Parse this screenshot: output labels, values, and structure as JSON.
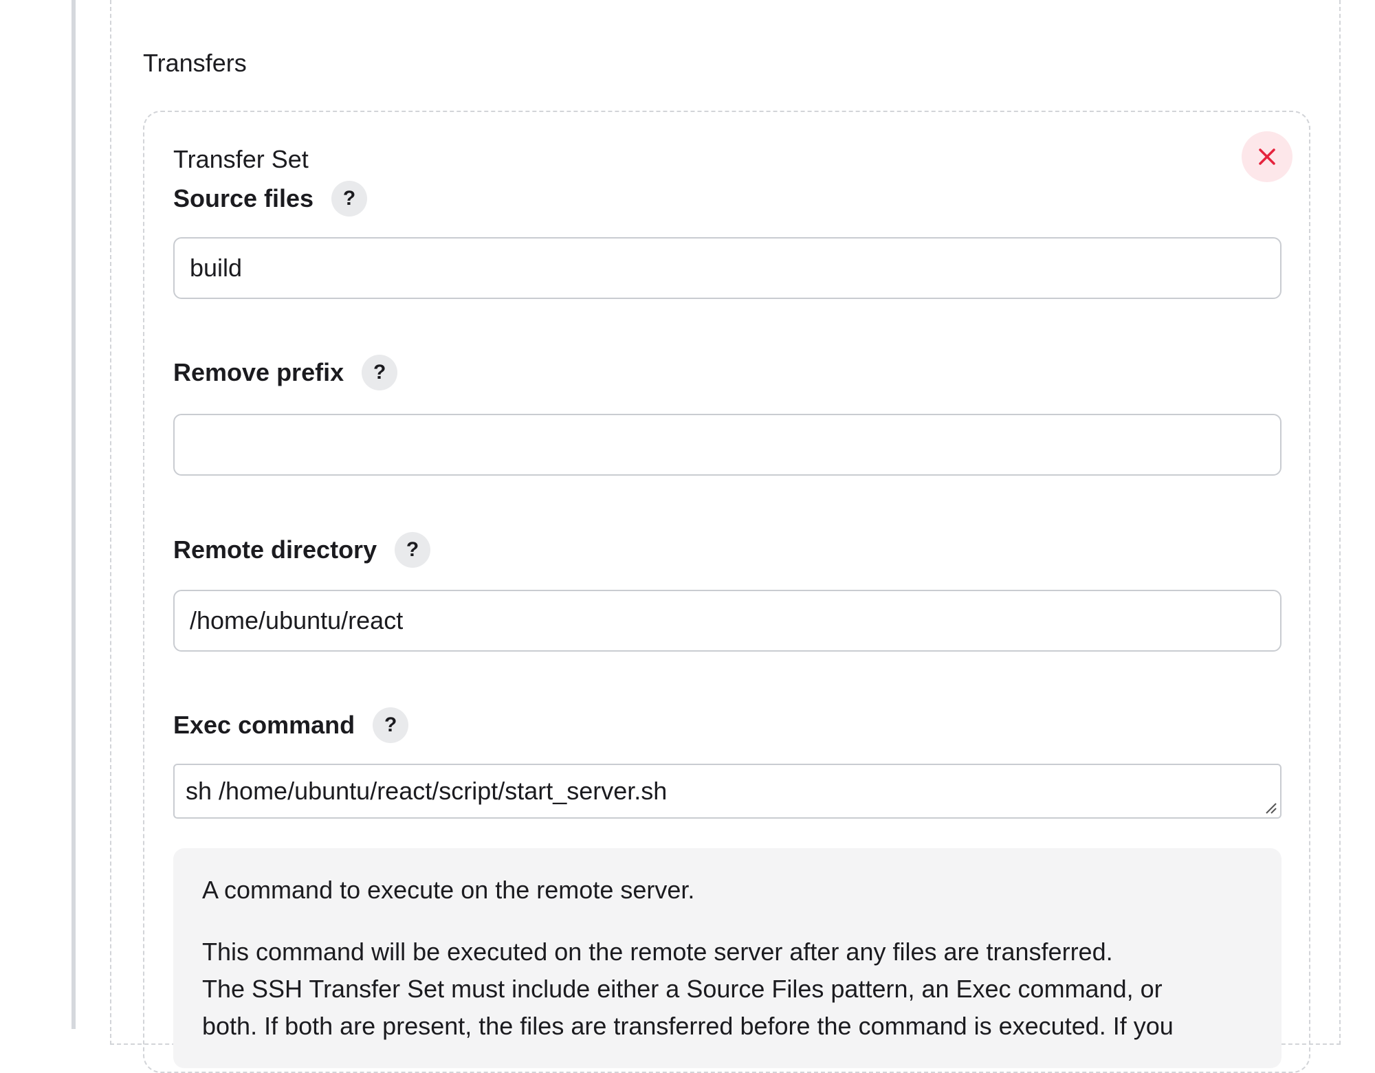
{
  "section": {
    "title": "Transfers"
  },
  "transfer_set": {
    "title": "Transfer Set",
    "remove_icon": "close-icon"
  },
  "fields": {
    "source_files": {
      "label": "Source files",
      "value": "build",
      "help": "?"
    },
    "remove_prefix": {
      "label": "Remove prefix",
      "value": "",
      "help": "?"
    },
    "remote_directory": {
      "label": "Remote directory",
      "value": "/home/ubuntu/react",
      "help": "?"
    },
    "exec_command": {
      "label": "Exec command",
      "value": "sh /home/ubuntu/react/script/start_server.sh",
      "help": "?"
    }
  },
  "help_text": {
    "line1": "A command to execute on the remote server.",
    "line2": "This command will be executed on the remote server after any files are transferred.",
    "line3": "The SSH Transfer Set must include either a Source Files pattern, an Exec command, or",
    "line4": "both. If both are present, the files are transferred before the command is executed. If you"
  },
  "colors": {
    "accent_danger": "#e5233d",
    "danger_bg": "#fde7ea",
    "border": "#c9ccd1",
    "dashed": "#d2d4d8",
    "help_bg": "#f4f4f5"
  }
}
